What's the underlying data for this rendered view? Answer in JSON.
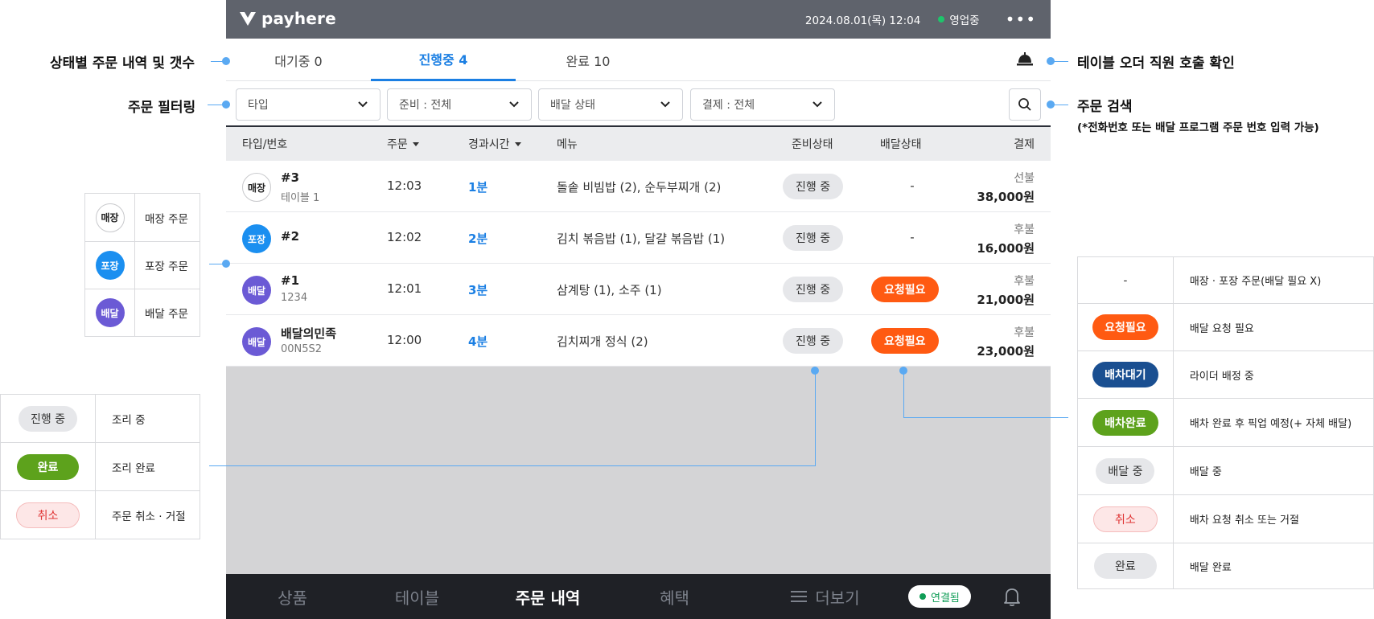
{
  "topbar": {
    "brand": "payhere",
    "datetime": "2024.08.01(목) 12:04",
    "status_text": "영업중",
    "more_glyph": "•••",
    "status_color": "#1ec46b"
  },
  "tabs": [
    {
      "label": "대기중 0"
    },
    {
      "label": "진행중 4"
    },
    {
      "label": "완료 10"
    }
  ],
  "filters": [
    {
      "label": "타입"
    },
    {
      "label": "준비 : 전체"
    },
    {
      "label": "배달 상태"
    },
    {
      "label": "결제 : 전체"
    }
  ],
  "table": {
    "headers": {
      "type_no": "타입/번호",
      "order": "주문",
      "elapsed": "경과시간",
      "menu": "메뉴",
      "prep": "준비상태",
      "delivery": "배달상태",
      "payment": "결제"
    },
    "rows": [
      {
        "type": "매장",
        "no": "#3",
        "sub": "테이블 1",
        "time": "12:03",
        "elapsed": "1분",
        "menu": "돌솥 비빔밥 (2), 순두부찌개 (2)",
        "prep": "진행 중",
        "delivery": "-",
        "pay_type": "선불",
        "amount": "38,000원"
      },
      {
        "type": "포장",
        "no": "#2",
        "sub": "",
        "time": "12:02",
        "elapsed": "2분",
        "menu": "김치 볶음밥 (1), 달걀 볶음밥 (1)",
        "prep": "진행 중",
        "delivery": "-",
        "pay_type": "후불",
        "amount": "16,000원"
      },
      {
        "type": "배달",
        "no": "#1",
        "sub": "1234",
        "time": "12:01",
        "elapsed": "3분",
        "menu": "삼계탕 (1), 소주 (1)",
        "prep": "진행 중",
        "delivery": "요청필요",
        "pay_type": "후불",
        "amount": "21,000원"
      },
      {
        "type": "배달",
        "no": "배달의민족",
        "sub": "00N5S2",
        "time": "12:00",
        "elapsed": "4분",
        "menu": "김치찌개 정식 (2)",
        "prep": "진행 중",
        "delivery": "요청필요",
        "pay_type": "후불",
        "amount": "23,000원"
      }
    ]
  },
  "bottom_nav": {
    "items": [
      "상품",
      "테이블",
      "주문 내역",
      "혜택",
      "더보기"
    ],
    "connection": "연결됨"
  },
  "annotations": {
    "status_tabs": "상태별 주문 내역 및 갯수",
    "order_filter": "주문 필터링",
    "staff_call": "테이블 오더 직원 호출 확인",
    "order_search": "주문 검색",
    "order_search_note": "(*전화번호 또는 배달 프로그램 주문 번호 입력 가능)"
  },
  "type_legend": [
    {
      "badge": "매장",
      "desc": "매장 주문"
    },
    {
      "badge": "포장",
      "desc": "포장 주문"
    },
    {
      "badge": "배달",
      "desc": "배달 주문"
    }
  ],
  "prep_legend": [
    {
      "badge": "진행 중",
      "desc": "조리 중"
    },
    {
      "badge": "완료",
      "desc": "조리 완료"
    },
    {
      "badge": "취소",
      "desc": "주문 취소 · 거절"
    }
  ],
  "delivery_legend": [
    {
      "badge": "-",
      "desc": "매장 · 포장 주문(배달 필요 X)"
    },
    {
      "badge": "요청필요",
      "desc": "배달 요청 필요"
    },
    {
      "badge": "배차대기",
      "desc": "라이더 배정 중"
    },
    {
      "badge": "배차완료",
      "desc": "배차 완료 후 픽업 예정(+ 자체 배달)"
    },
    {
      "badge": "배달 중",
      "desc": "배달 중"
    },
    {
      "badge": "취소",
      "desc": "배차 요청 취소 또는 거절"
    },
    {
      "badge": "완료",
      "desc": "배달 완료"
    }
  ],
  "colors": {
    "accent": "#1b7fe3",
    "takeout": "#1b8ff0",
    "delivery": "#6b5ad5",
    "request_needed": "#ff5a12",
    "dispatch_wait": "#1a4f91",
    "dispatch_done": "#5da21c",
    "annotation_line": "#5aa9f2"
  }
}
